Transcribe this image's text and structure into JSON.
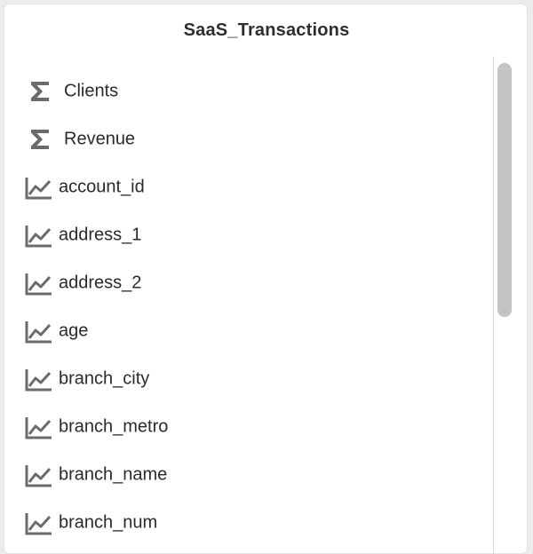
{
  "panel": {
    "title": "SaaS_Transactions"
  },
  "fields": [
    {
      "label": "Clients",
      "kind": "measure",
      "icon": "sigma-icon"
    },
    {
      "label": "Revenue",
      "kind": "measure",
      "icon": "sigma-icon"
    },
    {
      "label": "account_id",
      "kind": "dimension",
      "icon": "trend-line-icon"
    },
    {
      "label": "address_1",
      "kind": "dimension",
      "icon": "trend-line-icon"
    },
    {
      "label": "address_2",
      "kind": "dimension",
      "icon": "trend-line-icon"
    },
    {
      "label": "age",
      "kind": "dimension",
      "icon": "trend-line-icon"
    },
    {
      "label": "branch_city",
      "kind": "dimension",
      "icon": "trend-line-icon"
    },
    {
      "label": "branch_metro",
      "kind": "dimension",
      "icon": "trend-line-icon"
    },
    {
      "label": "branch_name",
      "kind": "dimension",
      "icon": "trend-line-icon"
    },
    {
      "label": "branch_num",
      "kind": "dimension",
      "icon": "trend-line-icon"
    }
  ],
  "colors": {
    "icon": "#6b6b6b",
    "text": "#2a2a2a",
    "scroll_thumb": "#c4c4c4"
  }
}
